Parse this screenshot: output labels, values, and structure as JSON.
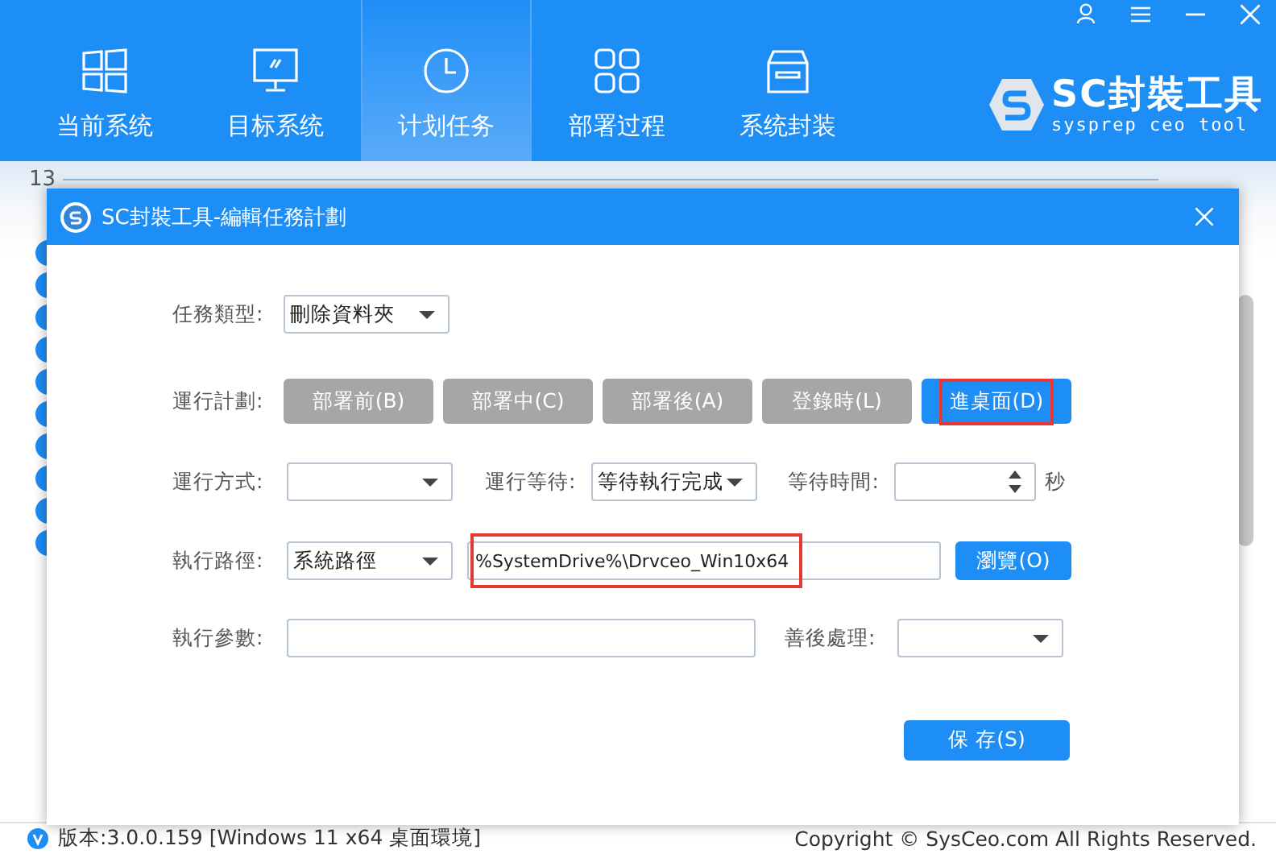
{
  "nav_tabs": [
    {
      "label": "当前系统",
      "kind": "windows",
      "selected": false
    },
    {
      "label": "目标系统",
      "kind": "monitor",
      "selected": false
    },
    {
      "label": "计划任务",
      "kind": "clock",
      "selected": true
    },
    {
      "label": "部署过程",
      "kind": "apps",
      "selected": false
    },
    {
      "label": "系统封装",
      "kind": "box",
      "selected": false
    }
  ],
  "logo": {
    "title": "SC封裝工具",
    "subtitle": "sysprep ceo tool"
  },
  "background": {
    "row_number": "13"
  },
  "dialog": {
    "title": "SC封裝工具-編輯任務計劃",
    "task_type": {
      "label": "任務類型:",
      "value": "刪除資料夾"
    },
    "schedule": {
      "label": "運行計劃:",
      "options": [
        {
          "label": "部署前(B)",
          "selected": false,
          "highlighted": false
        },
        {
          "label": "部署中(C)",
          "selected": false,
          "highlighted": false
        },
        {
          "label": "部署後(A)",
          "selected": false,
          "highlighted": false
        },
        {
          "label": "登錄時(L)",
          "selected": false,
          "highlighted": false
        },
        {
          "label": "進桌面(D)",
          "selected": true,
          "highlighted": true
        }
      ]
    },
    "run_mode": {
      "label": "運行方式:"
    },
    "run_wait": {
      "label": "運行等待:",
      "value": "等待執行完成"
    },
    "wait_time": {
      "label": "等待時間:",
      "unit": "秒"
    },
    "path": {
      "label": "執行路徑:",
      "type_value": "系統路徑",
      "value": "%SystemDrive%\\Drvceo_Win10x64",
      "highlighted": true,
      "browse_button": "瀏覽(O)"
    },
    "params": {
      "label": "執行參數:"
    },
    "cleanup": {
      "label": "善後處理:"
    },
    "save_button": "保 存(S)"
  },
  "status_bar": {
    "version": "版本:3.0.0.159 [Windows 11 x64 桌面環境]",
    "copyright": "Copyright © SysCeo.com All Rights Reserved."
  }
}
